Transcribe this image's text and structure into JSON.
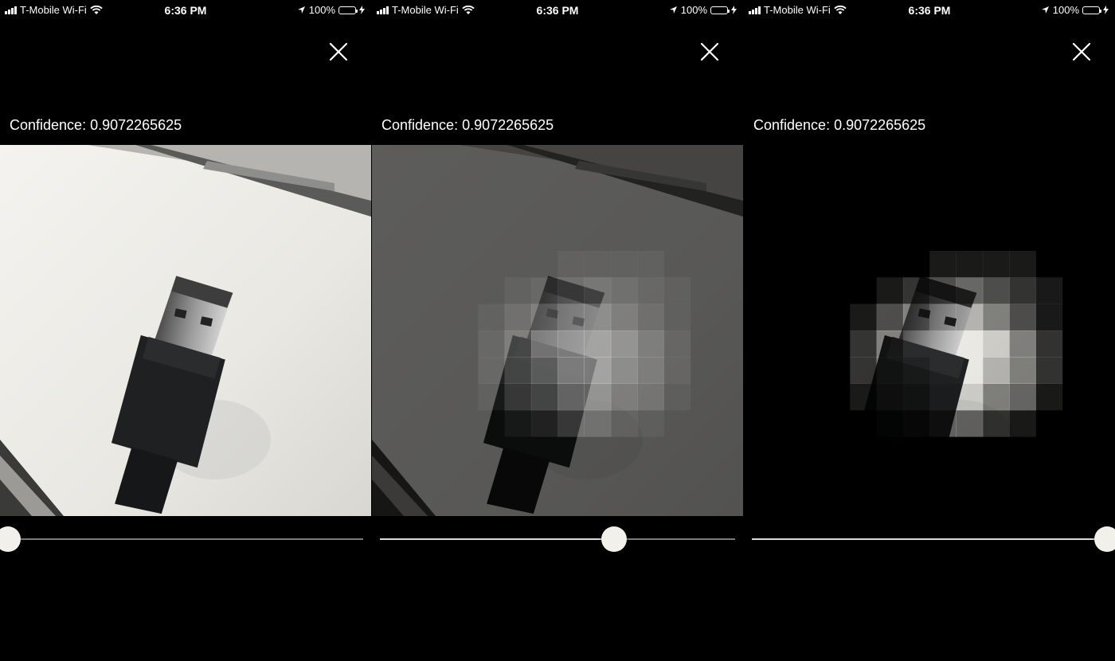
{
  "status_bar": {
    "carrier": "T-Mobile Wi-Fi",
    "time": "6:36 PM",
    "battery": "100%",
    "icons": [
      "signal-bars-icon",
      "wifi-icon",
      "location-arrow-icon",
      "battery-icon",
      "charging-bolt-icon"
    ]
  },
  "panels": [
    {
      "confidence": "Confidence: 0.9072265625",
      "mode": "original",
      "slider_value": 0.0
    },
    {
      "confidence": "Confidence: 0.9072265625",
      "mode": "heatmap-overlay",
      "slider_value": 0.66
    },
    {
      "confidence": "Confidence: 0.9072265625",
      "mode": "heatmap-only",
      "slider_value": 1.0
    }
  ],
  "icons": {
    "close": "close-icon",
    "image": "usb-cable-photo"
  },
  "colors": {
    "background": "#000000",
    "text": "#ffffff",
    "thumb": "#f2f0ea"
  }
}
